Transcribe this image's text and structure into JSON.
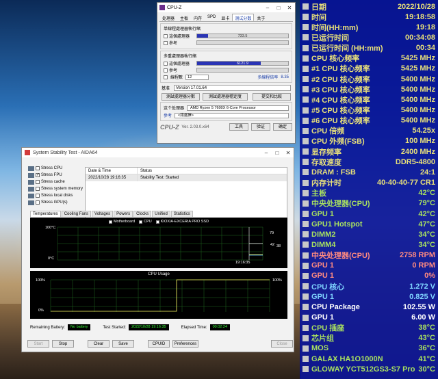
{
  "cpuz": {
    "title": "CPU-Z",
    "tabs": [
      "处理器",
      "主板",
      "内存",
      "SPD",
      "显卡",
      "测试分数",
      "关于"
    ],
    "active_tab": "测试分数",
    "single_group": "单線程處理器執行緒",
    "single_this": "這個處理器",
    "single_this_value": "733.5",
    "single_this_pct": 0.12,
    "ref_label": "參考",
    "multi_group": "多重處理器執行緒",
    "multi_this_value": "6121.9",
    "multi_this_pct": 0.7,
    "threads_label": "線程數",
    "threads_value": "12",
    "multi_ratio_label": "多線程倍率",
    "multi_ratio_value": "8.35",
    "bench_label": "基准",
    "bench_version": "Version 17.01.64",
    "btn_test": "測試處理器分數",
    "btn_stability": "測試處理器穩定度",
    "btn_submit": "提交和比較",
    "this_proc_label": "这个处理器",
    "proc_name": "AMD Ryzen 5 7600X 6-Core Processor",
    "ref_select": "<請選擇>",
    "brand": "CPU-Z",
    "version": "Ver. 2.03.0.x64",
    "tools": "工具",
    "validate": "验证",
    "ok": "确定"
  },
  "aida": {
    "title": "System Stability Test - AIDA64",
    "stress": [
      {
        "label": "Stress CPU",
        "checked": false
      },
      {
        "label": "Stress FPU",
        "checked": true
      },
      {
        "label": "Stress cache",
        "checked": false
      },
      {
        "label": "Stress system memory",
        "checked": false
      },
      {
        "label": "Stress local disks",
        "checked": false
      },
      {
        "label": "Stress GPU(s)",
        "checked": false
      }
    ],
    "col_date": "Date & Time",
    "col_status": "Status",
    "evt_date": "2022/10/28 19:16:35",
    "evt_status": "Stability Test: Started",
    "tabs": [
      "Temperatures",
      "Cooling Fans",
      "Voltages",
      "Powers",
      "Clocks",
      "Unified",
      "Statistics"
    ],
    "legend": [
      "Motherboard",
      "CPU",
      "KIOXIA-EXCERIA PRO SSD"
    ],
    "temp_top": "100°C",
    "temp_bottom": "0°C",
    "time_label": "19:16:35",
    "temp_val_1": "79",
    "temp_val_2": "42",
    "temp_val_3": "38",
    "cpu_usage_title": "CPU Usage",
    "usage_top": "100%",
    "usage_bottom": "0%",
    "usage_right": "100%",
    "remaining_battery_label": "Remaining Battery:",
    "remaining_battery": "No battery",
    "test_started_label": "Test Started:",
    "test_started": "2022/10/28 19:16:35",
    "elapsed_label": "Elapsed Time:",
    "elapsed": "00:02:24",
    "buttons": [
      "Start",
      "Stop",
      "Clear",
      "Save",
      "CPUID",
      "Preferences",
      "Close"
    ]
  },
  "sensor": {
    "rows": [
      {
        "label": "日期",
        "value": "2022/10/28",
        "label_color": "#e8e07a",
        "value_color": "#e8e07a"
      },
      {
        "label": "时间",
        "value": "19:18:58",
        "label_color": "#e8e07a",
        "value_color": "#e8e07a"
      },
      {
        "label": "时间(HH:mm)",
        "value": "19:18",
        "label_color": "#e8e07a",
        "value_color": "#e8e07a"
      },
      {
        "label": "已运行时间",
        "value": "00:34:08",
        "label_color": "#e8e07a",
        "value_color": "#e8e07a"
      },
      {
        "label": "已运行时间 (HH:mm)",
        "value": "00:34",
        "label_color": "#e8e07a",
        "value_color": "#e8e07a"
      },
      {
        "label": "CPU 核心频率",
        "value": "5425 MHz",
        "label_color": "#e8e07a",
        "value_color": "#e8e07a"
      },
      {
        "label": "#1 CPU 核心频率",
        "value": "5425 MHz",
        "label_color": "#e8e07a",
        "value_color": "#e8e07a"
      },
      {
        "label": "#2 CPU 核心频率",
        "value": "5400 MHz",
        "label_color": "#e8e07a",
        "value_color": "#e8e07a"
      },
      {
        "label": "#3 CPU 核心频率",
        "value": "5400 MHz",
        "label_color": "#e8e07a",
        "value_color": "#e8e07a"
      },
      {
        "label": "#4 CPU 核心频率",
        "value": "5400 MHz",
        "label_color": "#e8e07a",
        "value_color": "#e8e07a"
      },
      {
        "label": "#5 CPU 核心频率",
        "value": "5400 MHz",
        "label_color": "#e8e07a",
        "value_color": "#e8e07a"
      },
      {
        "label": "#6 CPU 核心频率",
        "value": "5400 MHz",
        "label_color": "#e8e07a",
        "value_color": "#e8e07a"
      },
      {
        "label": "CPU 倍频",
        "value": "54.25x",
        "label_color": "#e8e07a",
        "value_color": "#e8e07a"
      },
      {
        "label": "CPU 外频(FSB)",
        "value": "100 MHz",
        "label_color": "#e8e07a",
        "value_color": "#e8e07a"
      },
      {
        "label": "显存频率",
        "value": "2400 MHz",
        "label_color": "#e8e07a",
        "value_color": "#e8e07a"
      },
      {
        "label": "存取速度",
        "value": "DDR5-4800",
        "label_color": "#e8e07a",
        "value_color": "#e8e07a"
      },
      {
        "label": "DRAM : FSB",
        "value": "24:1",
        "label_color": "#e8e07a",
        "value_color": "#e8e07a"
      },
      {
        "label": "内存计时",
        "value": "40-40-40-77 CR1",
        "label_color": "#e8e07a",
        "value_color": "#e8e07a"
      },
      {
        "label": "主板",
        "value": "42°C",
        "label_color": "#a8e060",
        "value_color": "#a8e060"
      },
      {
        "label": "中央处理器(CPU)",
        "value": "79°C",
        "label_color": "#a8e060",
        "value_color": "#a8e060"
      },
      {
        "label": "GPU 1",
        "value": "42°C",
        "label_color": "#a8e060",
        "value_color": "#a8e060"
      },
      {
        "label": "GPU1 Hotspot",
        "value": "47°C",
        "label_color": "#a8e060",
        "value_color": "#a8e060"
      },
      {
        "label": "DIMM2",
        "value": "34°C",
        "label_color": "#a8e060",
        "value_color": "#a8e060"
      },
      {
        "label": "DIMM4",
        "value": "34°C",
        "label_color": "#a8e060",
        "value_color": "#a8e060"
      },
      {
        "label": "中央处理器(CPU)",
        "value": "2758 RPM",
        "label_color": "#ff8a80",
        "value_color": "#ff8a80"
      },
      {
        "label": "GPU 1",
        "value": "0 RPM",
        "label_color": "#ff8a80",
        "value_color": "#ff8a80"
      },
      {
        "label": "GPU 1",
        "value": "0%",
        "label_color": "#ff8a80",
        "value_color": "#ff8a80"
      },
      {
        "label": "CPU 核心",
        "value": "1.272 V",
        "label_color": "#7fd4ff",
        "value_color": "#7fd4ff"
      },
      {
        "label": "GPU 1",
        "value": "0.825 V",
        "label_color": "#7fd4ff",
        "value_color": "#7fd4ff"
      },
      {
        "label": "CPU Package",
        "value": "102.55 W",
        "label_color": "#ffffff",
        "value_color": "#ffffff"
      },
      {
        "label": "GPU 1",
        "value": "6.00 W",
        "label_color": "#ffffff",
        "value_color": "#ffffff"
      },
      {
        "label": "CPU 插座",
        "value": "38°C",
        "label_color": "#a8e060",
        "value_color": "#a8e060"
      },
      {
        "label": "芯片组",
        "value": "43°C",
        "label_color": "#a8e060",
        "value_color": "#a8e060"
      },
      {
        "label": "MOS",
        "value": "36°C",
        "label_color": "#a8e060",
        "value_color": "#a8e060"
      },
      {
        "label": "GALAX HA1O1000N",
        "value": "41°C",
        "label_color": "#a8e060",
        "value_color": "#a8e060"
      },
      {
        "label": "GLOWAY YCT512GS3-S7 Pro",
        "value": "30°C",
        "label_color": "#a8e060",
        "value_color": "#a8e060"
      }
    ]
  }
}
